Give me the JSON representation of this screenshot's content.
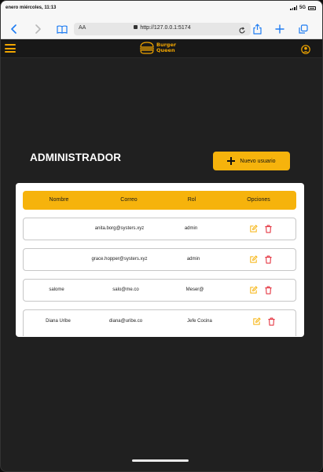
{
  "status_bar": {
    "time": "enero miércoles, 11:13",
    "network": "5G"
  },
  "browser": {
    "text_size_label": "AA",
    "url": "http://127.0.0.1:5174",
    "icons": [
      "back-icon",
      "forward-icon",
      "book-icon",
      "reload-icon",
      "share-icon",
      "new-tab-icon",
      "tabs-icon"
    ]
  },
  "app": {
    "logo_line1": "Burger",
    "logo_line2": "Queen",
    "accent": "#f6b30c"
  },
  "page": {
    "title": "ADMINISTRADOR",
    "new_user_label": "Nuevo usuario"
  },
  "table": {
    "headers": [
      "Nombre",
      "Correo",
      "Rol",
      "Opciones"
    ],
    "rows": [
      {
        "name": "",
        "email": "anita.borg@systers.xyz",
        "role": "admin"
      },
      {
        "name": "",
        "email": "grace.hopper@systers.xyz",
        "role": "admin"
      },
      {
        "name": "salome",
        "email": "salo@me.co",
        "role": "Meser@"
      },
      {
        "name": "Diana Uribe",
        "email": "diana@uribe.co",
        "role": "Jefe Cocina"
      }
    ],
    "edit_color": "#f6b30c",
    "delete_color": "#e53945"
  }
}
